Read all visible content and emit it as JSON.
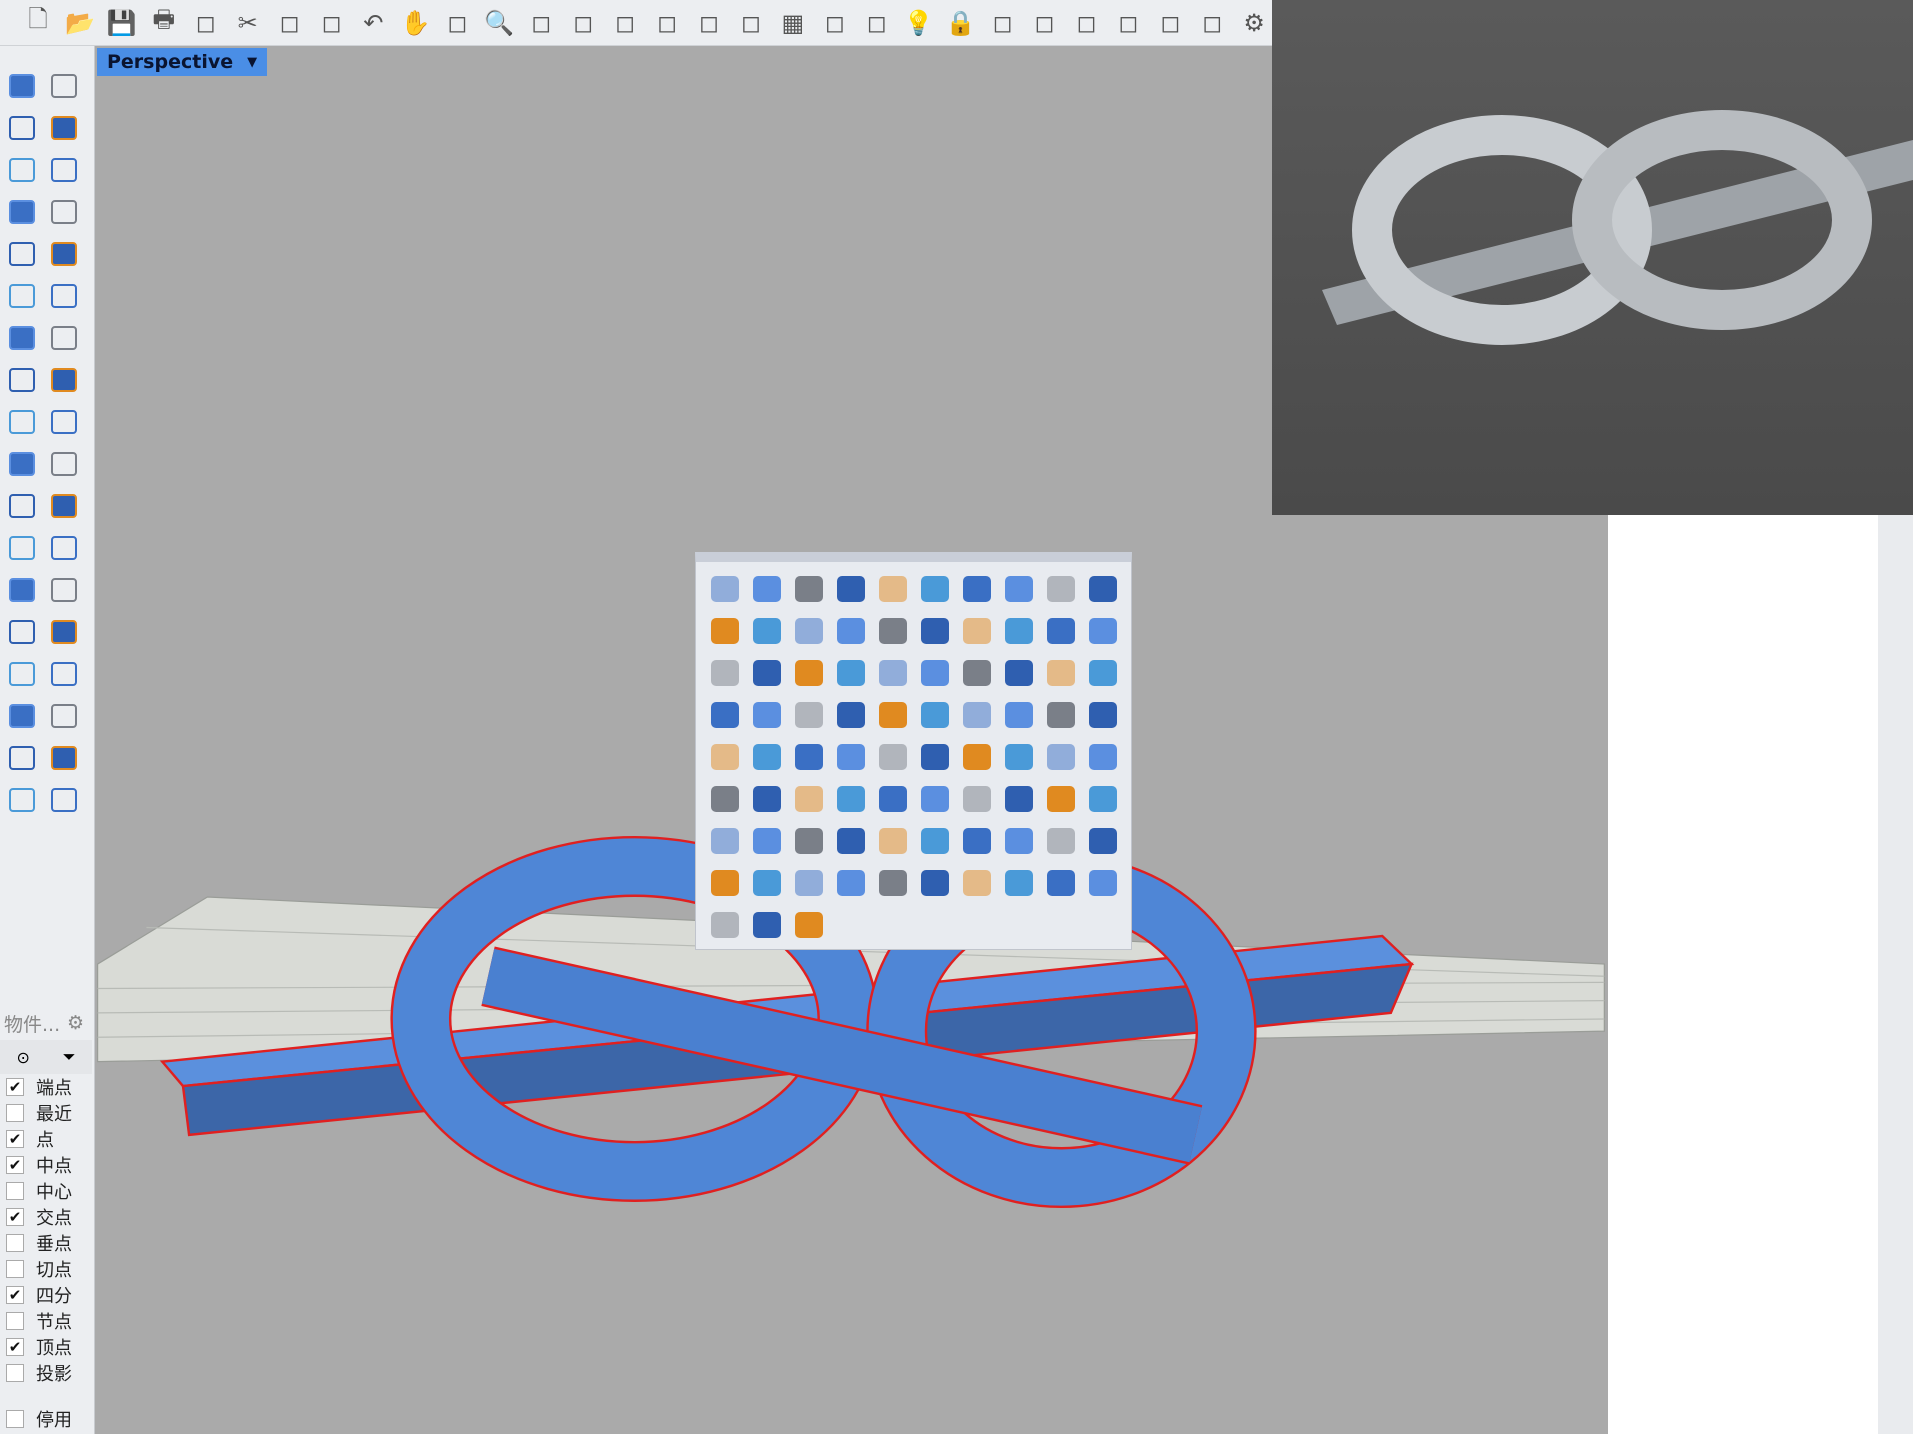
{
  "viewport": {
    "title": "Perspective"
  },
  "toolbar": {
    "icons": [
      "new-file",
      "open-folder",
      "save",
      "print",
      "page",
      "cut",
      "copy",
      "paste",
      "undo",
      "pan",
      "rotate-view",
      "zoom",
      "zoom-window",
      "zoom-extents",
      "zoom-selected",
      "rotate",
      "four-views",
      "car",
      "grid",
      "circle-snap",
      "points",
      "bulb",
      "lock",
      "layers",
      "color-wheel",
      "shaded-sphere",
      "rendered-sphere",
      "blue-sphere",
      "pen",
      "gear"
    ]
  },
  "osnap": {
    "header": "物件...",
    "items": [
      {
        "label": "端点",
        "checked": true
      },
      {
        "label": "最近",
        "checked": false
      },
      {
        "label": "点",
        "checked": true
      },
      {
        "label": "中点",
        "checked": true
      },
      {
        "label": "中心",
        "checked": false
      },
      {
        "label": "交点",
        "checked": true
      },
      {
        "label": "垂点",
        "checked": false
      },
      {
        "label": "切点",
        "checked": false
      },
      {
        "label": "四分",
        "checked": true
      },
      {
        "label": "节点",
        "checked": false
      },
      {
        "label": "顶点",
        "checked": true
      },
      {
        "label": "投影",
        "checked": false
      }
    ],
    "disable": {
      "label": "停用",
      "checked": false
    }
  },
  "popup": {
    "icon_count": 83
  },
  "colors": {
    "model": "#4f86d6",
    "edge": "#e02020",
    "accent": "#4a8ee6"
  }
}
